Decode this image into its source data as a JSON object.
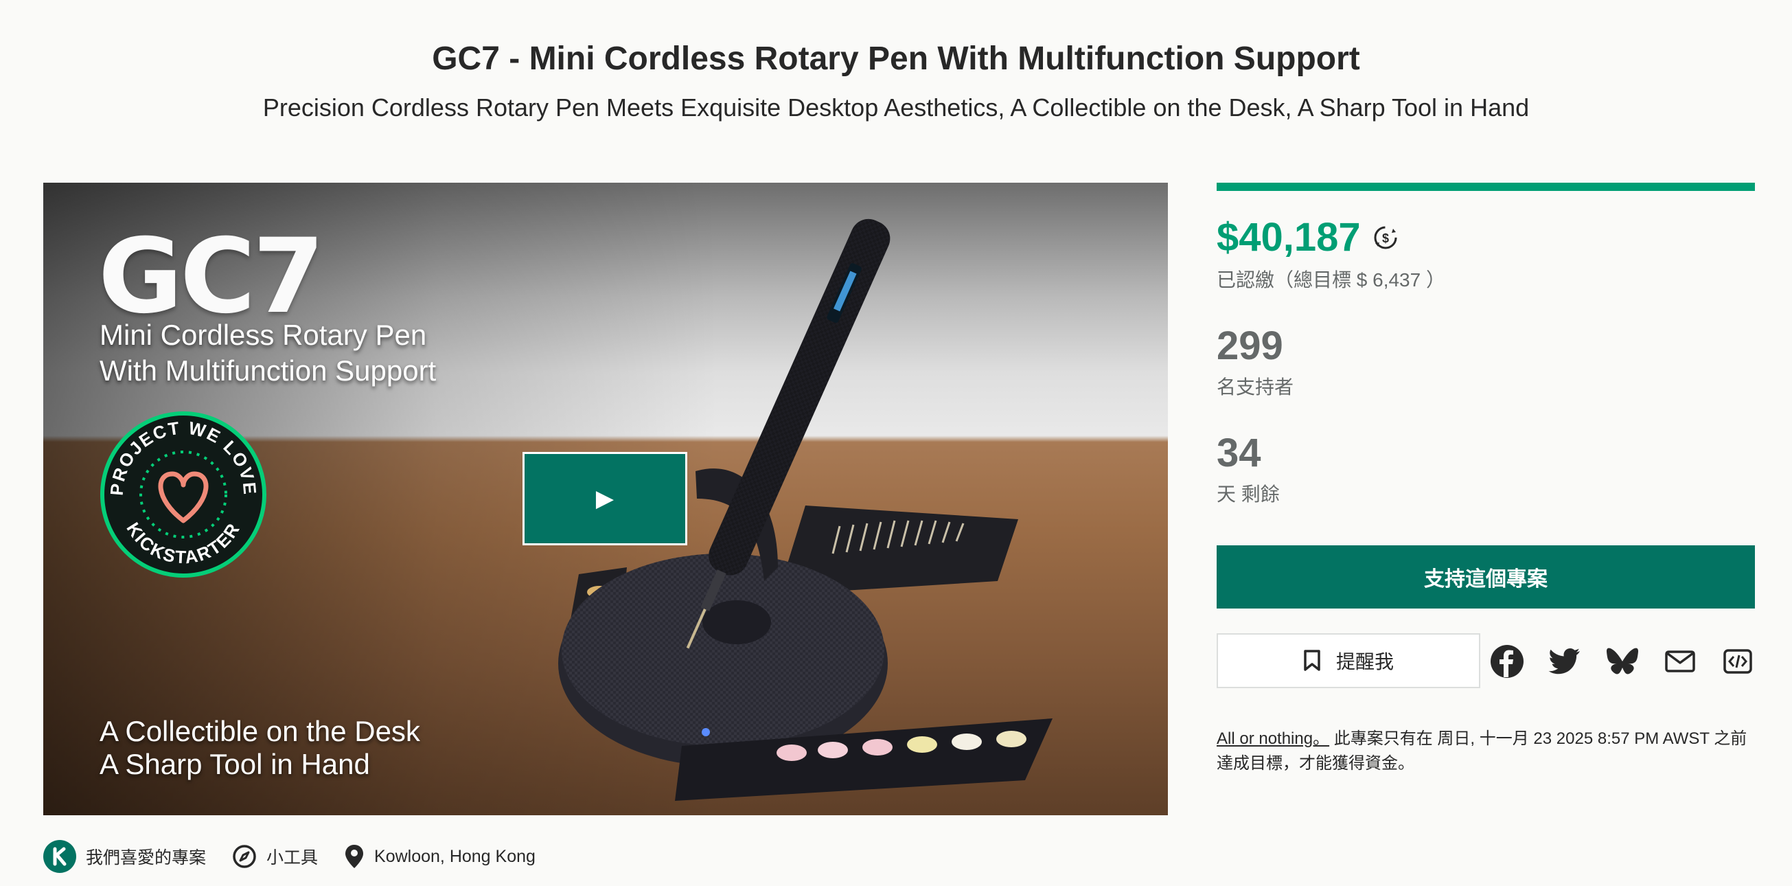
{
  "project": {
    "title": "GC7 - Mini Cordless Rotary Pen With Multifunction Support",
    "subtitle": "Precision Cordless Rotary Pen Meets Exquisite Desktop Aesthetics, A Collectible on the Desk, A Sharp Tool in Hand"
  },
  "media": {
    "brand": "GC7",
    "tagline_1a": "Mini Cordless Rotary Pen",
    "tagline_1b": "With Multifunction Support",
    "tagline_2a": "A Collectible on the Desk",
    "tagline_2b": "A Sharp Tool in Hand",
    "badge_top": "PROJECT WE LOVE",
    "badge_bottom": "KICKSTARTER",
    "play_icon": "play-icon"
  },
  "stats": {
    "progress_fraction": 1.0,
    "pledged": "$40,187",
    "currency_icon": "currency-convert-icon",
    "goal_text": "已認繳（總目標 $ 6,437 ）",
    "backers": "299",
    "backers_label": "名支持者",
    "days": "34",
    "days_label": "天 剩餘"
  },
  "actions": {
    "back_label": "支持這個專案",
    "remind_label": "提醒我",
    "share_icons": [
      "facebook-icon",
      "twitter-icon",
      "bluesky-icon",
      "email-icon",
      "embed-icon"
    ]
  },
  "fine_print": {
    "link": "All or nothing。",
    "text": " 此專案只有在 周日, 十一月 23 2025 8:57 PM AWST 之前達成目標，才能獲得資金。"
  },
  "meta": {
    "pwl_label": "我們喜愛的專案",
    "category_label": "小工具",
    "location_label": "Kowloon, Hong Kong"
  },
  "colors": {
    "accent": "#009e74",
    "button": "#037362",
    "text": "#282828",
    "muted": "#656969"
  }
}
